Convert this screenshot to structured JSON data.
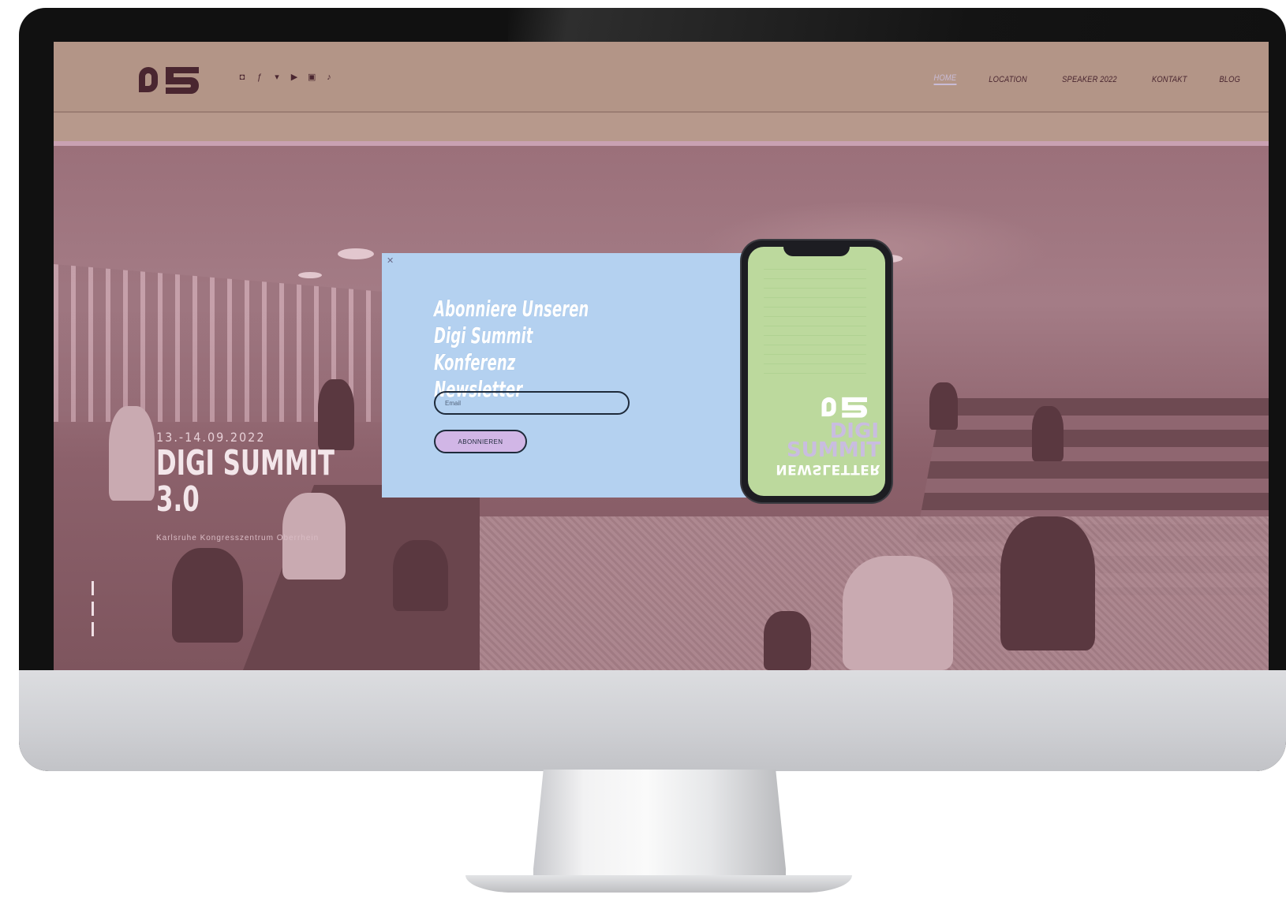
{
  "site": {
    "logo_text": "DS",
    "social_icons": [
      "instagram-icon",
      "facebook-icon",
      "twitter-icon",
      "youtube-icon",
      "linkedin-icon",
      "tiktok-icon"
    ],
    "nav": [
      {
        "label": "HOME",
        "active": true
      },
      {
        "label": "LOCATION",
        "active": false
      },
      {
        "label": "SPEAKER 2022",
        "active": false
      },
      {
        "label": "KONTAKT",
        "active": false
      },
      {
        "label": "BLOG",
        "active": false
      }
    ]
  },
  "hero": {
    "date": "13.-14.09.2022",
    "title": "DIGI SUMMIT 3.0",
    "subtitle": "Karlsruhe Kongresszentrum Oberrhein"
  },
  "popup": {
    "close_label": "✕",
    "title": "Abonniere Unseren Digi Summit Konferenz Newsletter",
    "email_placeholder": "Email",
    "submit_label": "ABONNIEREN",
    "phone": {
      "line1": "DIGI",
      "line2": "SUMMIT",
      "line3": "NEWSLETTER"
    }
  },
  "colors": {
    "header_bg": "#b39587",
    "hero_tint": "#8a5963",
    "popup_bg": "#b4d1f0",
    "button_bg": "#d1b6e6",
    "phone_bg": "#bcd99d",
    "brand_dark": "#4a2630"
  }
}
